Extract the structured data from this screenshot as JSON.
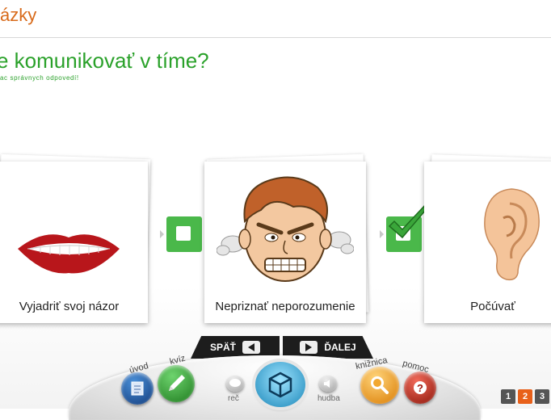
{
  "header": {
    "title": "ázky"
  },
  "question": {
    "text": "e komunikovať v tíme?",
    "instruction": "ac správnych odpovedí!"
  },
  "cards": [
    {
      "label": "Vyjadriť svoj názor",
      "image": "lips-image",
      "checked": false
    },
    {
      "label": "Nepriznať neporozumenie",
      "image": "angry-face-image",
      "checked": true
    },
    {
      "label": "Počúvať",
      "image": "ear-image",
      "checked": false
    }
  ],
  "nav": {
    "back_label": "SPÄŤ",
    "next_label": "ĎALEJ"
  },
  "dock": {
    "uvod": "úvod",
    "kviz": "kvíz",
    "rec": "reč",
    "hudba": "hudba",
    "kniznica": "knižnica",
    "pomoc": "pomoc"
  },
  "pages": [
    "1",
    "2",
    "3"
  ],
  "colors": {
    "accent_orange": "#d86a1a",
    "accent_green": "#2aa12a",
    "check_green": "#4ab84a"
  }
}
